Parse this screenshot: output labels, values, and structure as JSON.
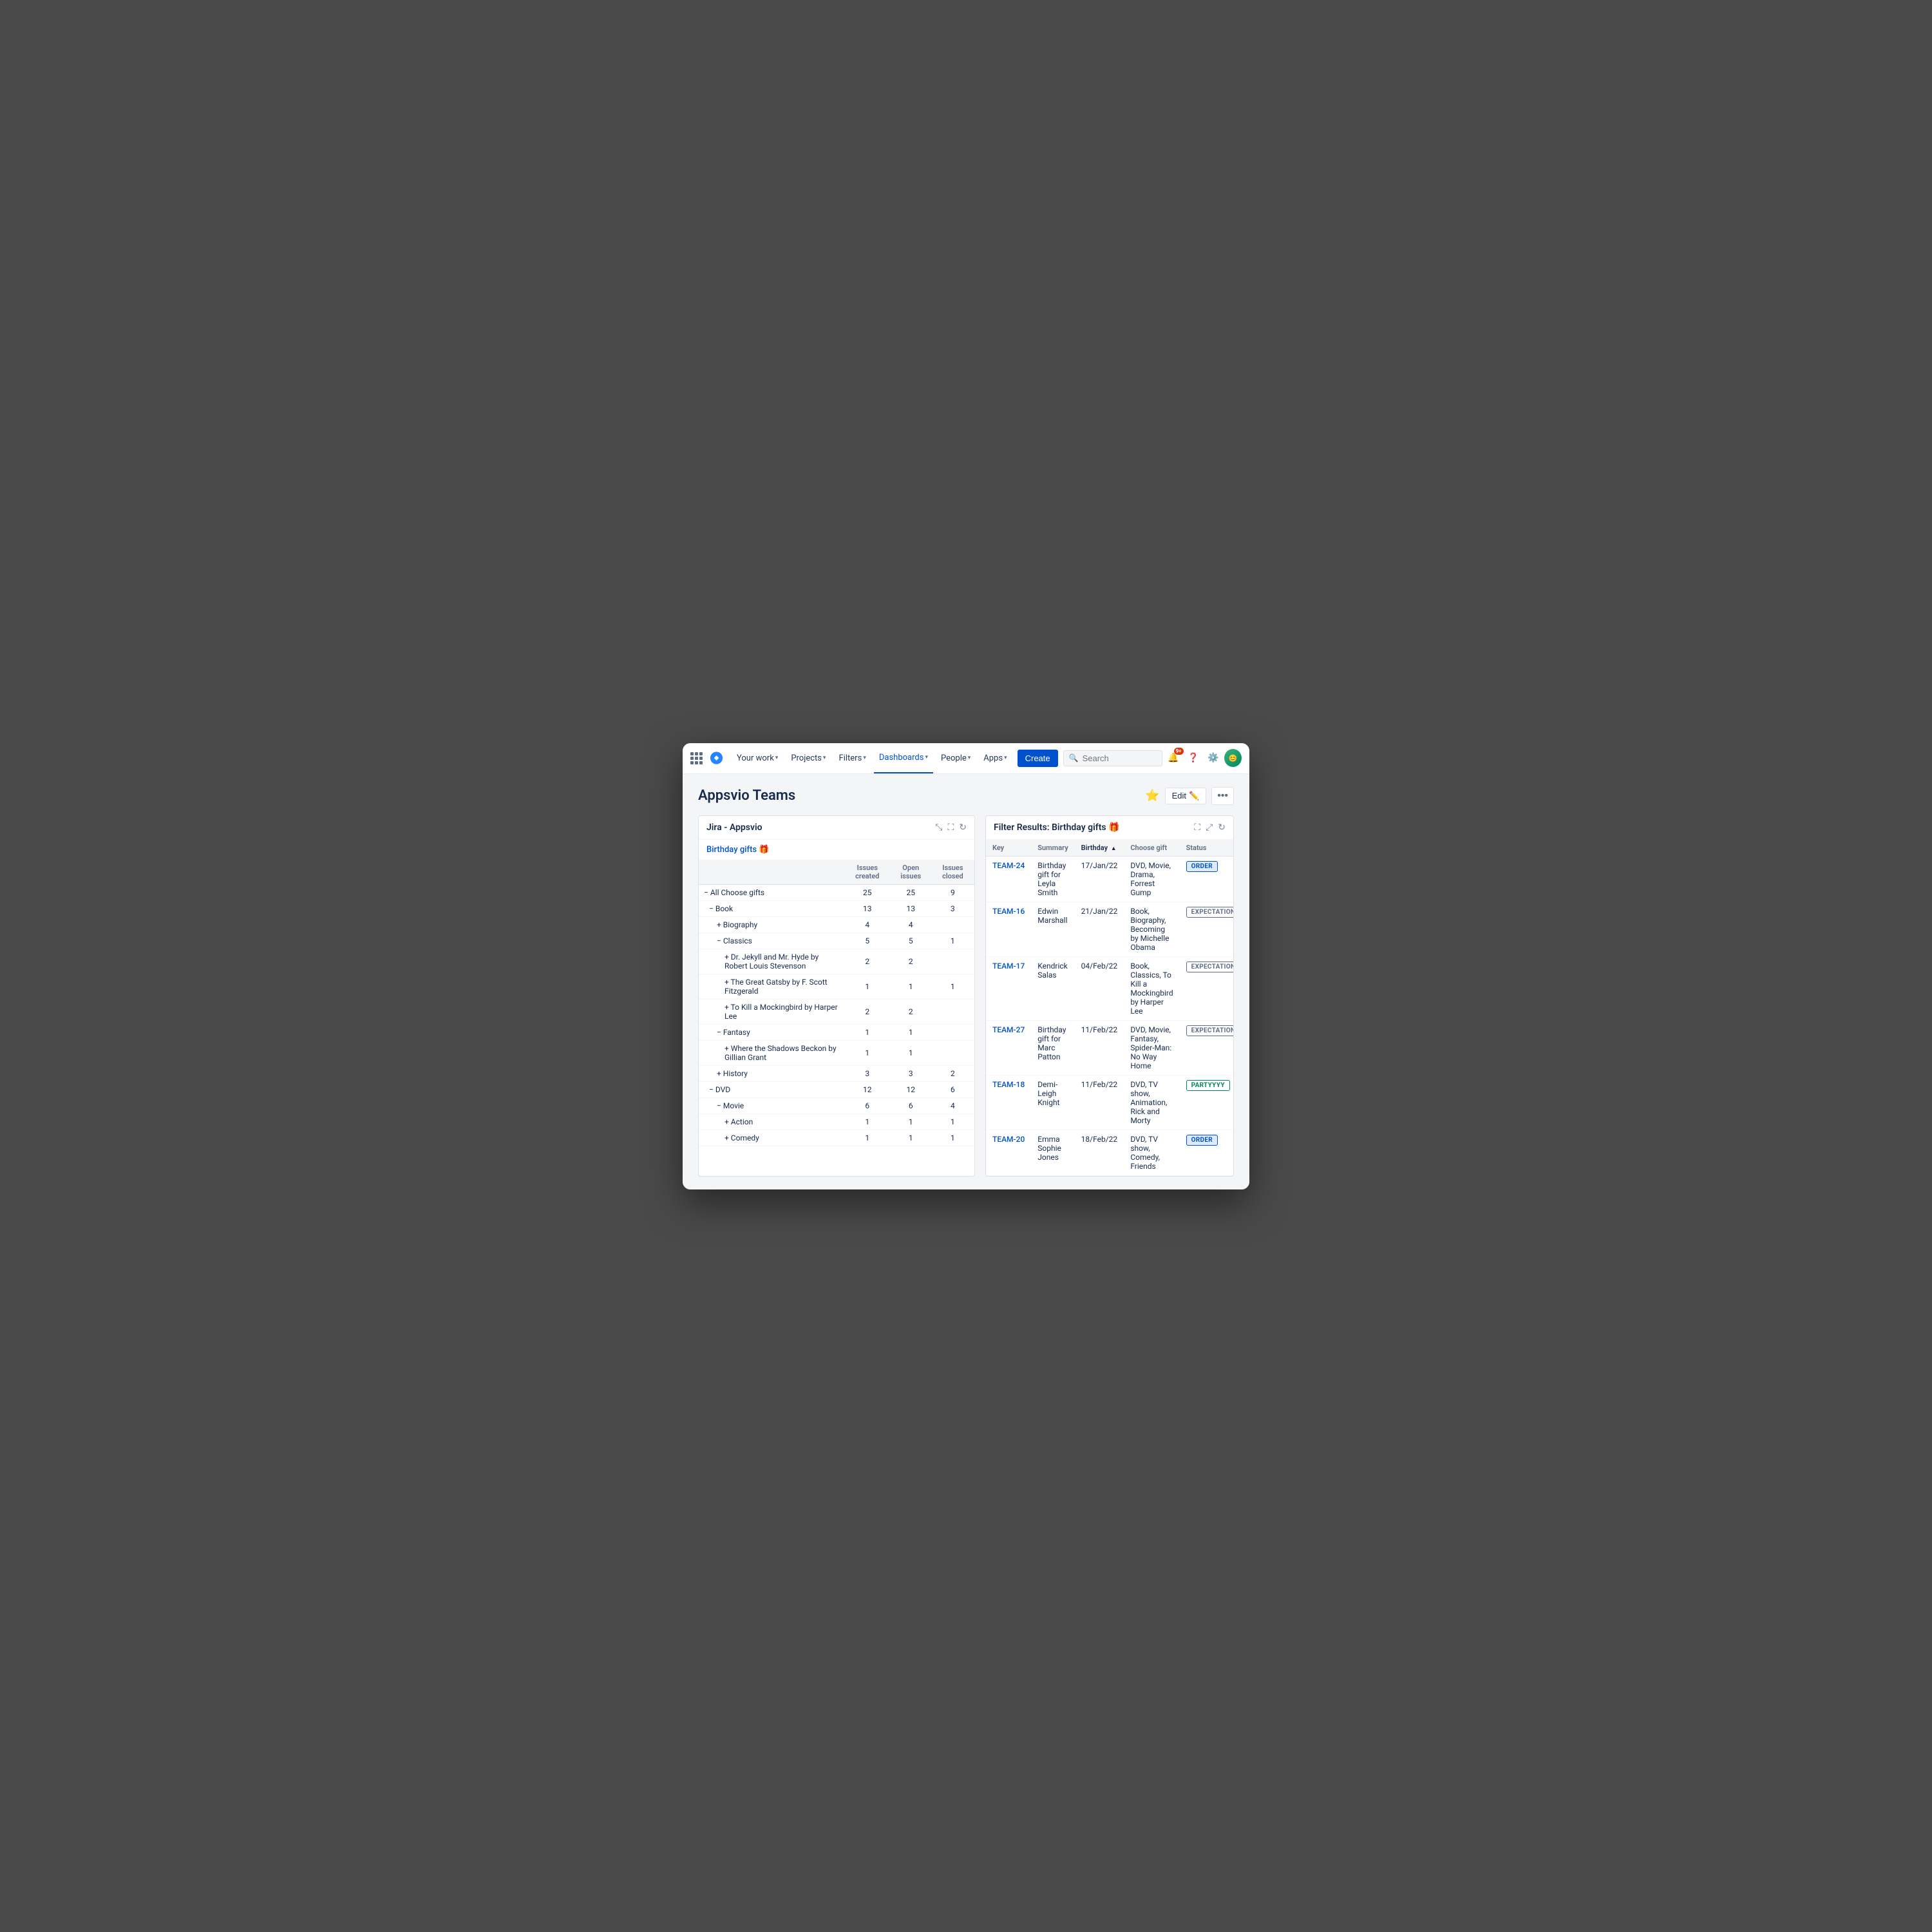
{
  "nav": {
    "your_work": "Your work",
    "projects": "Projects",
    "filters": "Filters",
    "dashboards": "Dashboards",
    "people": "People",
    "apps": "Apps",
    "create": "Create",
    "search_placeholder": "Search",
    "notification_badge": "9+",
    "edit_label": "Edit"
  },
  "page": {
    "title": "Appsvio Teams",
    "star": "⭐",
    "edit_icon": "✏️",
    "more": "•••"
  },
  "left_panel": {
    "title": "Jira - Appsvio",
    "link": "Birthday gifts 🎁",
    "columns": {
      "label": "",
      "issues_created": "Issues created",
      "open_issues": "Open issues",
      "issues_closed": "Issues closed"
    },
    "rows": [
      {
        "label": "− All Choose gifts",
        "indent": 0,
        "created": "25",
        "open": "25",
        "closed": "9"
      },
      {
        "label": "− Book",
        "indent": 1,
        "created": "13",
        "open": "13",
        "closed": "3"
      },
      {
        "label": "+ Biography",
        "indent": 2,
        "created": "4",
        "open": "4",
        "closed": ""
      },
      {
        "label": "− Classics",
        "indent": 2,
        "created": "5",
        "open": "5",
        "closed": "1"
      },
      {
        "label": "+ Dr. Jekyll and Mr. Hyde by Robert Louis Stevenson",
        "indent": 3,
        "created": "2",
        "open": "2",
        "closed": ""
      },
      {
        "label": "+ The Great Gatsby by F. Scott Fitzgerald",
        "indent": 3,
        "created": "1",
        "open": "1",
        "closed": "1"
      },
      {
        "label": "+ To Kill a Mockingbird by Harper Lee",
        "indent": 3,
        "created": "2",
        "open": "2",
        "closed": ""
      },
      {
        "label": "− Fantasy",
        "indent": 2,
        "created": "1",
        "open": "1",
        "closed": ""
      },
      {
        "label": "+ Where the Shadows Beckon by Gillian Grant",
        "indent": 3,
        "created": "1",
        "open": "1",
        "closed": ""
      },
      {
        "label": "+ History",
        "indent": 2,
        "created": "3",
        "open": "3",
        "closed": "2"
      },
      {
        "label": "− DVD",
        "indent": 1,
        "created": "12",
        "open": "12",
        "closed": "6"
      },
      {
        "label": "− Movie",
        "indent": 2,
        "created": "6",
        "open": "6",
        "closed": "4"
      },
      {
        "label": "+ Action",
        "indent": 3,
        "created": "1",
        "open": "1",
        "closed": "1"
      },
      {
        "label": "+ Comedy",
        "indent": 3,
        "created": "1",
        "open": "1",
        "closed": "1"
      }
    ]
  },
  "right_panel": {
    "title": "Filter Results: Birthday gifts 🎁",
    "columns": {
      "key": "Key",
      "summary": "Summary",
      "birthday": "Birthday",
      "choose_gift": "Choose gift",
      "status": "Status"
    },
    "rows": [
      {
        "key": "TEAM-24",
        "summary": "Birthday gift for Leyla Smith",
        "birthday": "17/Jan/22",
        "choose_gift": "DVD, Movie, Drama, Forrest Gump",
        "status": "ORDER",
        "status_type": "order"
      },
      {
        "key": "TEAM-16",
        "summary": "Edwin Marshall",
        "birthday": "21/Jan/22",
        "choose_gift": "Book, Biography, Becoming by Michelle Obama",
        "status": "EXPECTATION",
        "status_type": "expectation"
      },
      {
        "key": "TEAM-17",
        "summary": "Kendrick Salas",
        "birthday": "04/Feb/22",
        "choose_gift": "Book, Classics, To Kill a Mockingbird by Harper Lee",
        "status": "EXPECTATION",
        "status_type": "expectation"
      },
      {
        "key": "TEAM-27",
        "summary": "Birthday gift for Marc Patton",
        "birthday": "11/Feb/22",
        "choose_gift": "DVD, Movie, Fantasy, Spider-Man: No Way Home",
        "status": "EXPECTATION",
        "status_type": "expectation"
      },
      {
        "key": "TEAM-18",
        "summary": "Demi-Leigh Knight",
        "birthday": "11/Feb/22",
        "choose_gift": "DVD, TV show, Animation, Rick and Morty",
        "status": "PARTYYYY",
        "status_type": "partyyyy"
      },
      {
        "key": "TEAM-20",
        "summary": "Emma Sophie Jones",
        "birthday": "18/Feb/22",
        "choose_gift": "DVD, TV show, Comedy, Friends",
        "status": "ORDER",
        "status_type": "order"
      }
    ]
  }
}
